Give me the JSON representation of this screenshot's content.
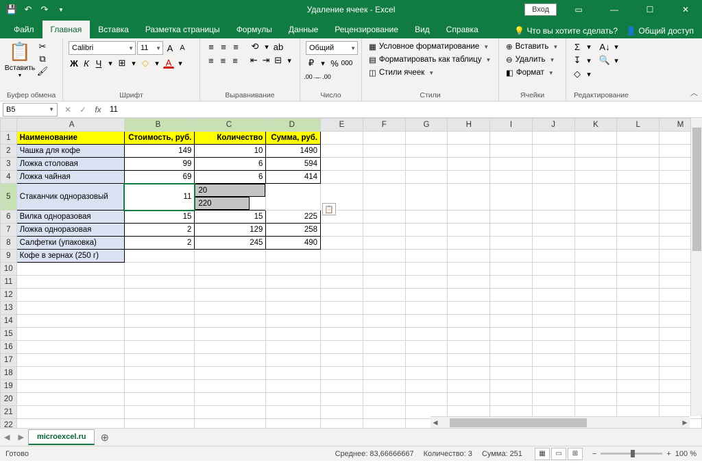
{
  "app": {
    "title": "Удаление ячеек  -  Excel",
    "login": "Вход"
  },
  "tabs": [
    "Файл",
    "Главная",
    "Вставка",
    "Разметка страницы",
    "Формулы",
    "Данные",
    "Рецензирование",
    "Вид",
    "Справка"
  ],
  "tellme": "Что вы хотите сделать?",
  "share": "Общий доступ",
  "ribbon": {
    "clipboard": {
      "label": "Буфер обмена",
      "paste": "Вставить"
    },
    "font": {
      "label": "Шрифт",
      "name": "Calibri",
      "size": "11",
      "bold": "Ж",
      "italic": "К",
      "underline": "Ч"
    },
    "align": {
      "label": "Выравнивание"
    },
    "number": {
      "label": "Число",
      "format": "Общий"
    },
    "styles": {
      "label": "Стили",
      "cond": "Условное форматирование",
      "table": "Форматировать как таблицу",
      "cell": "Стили ячеек"
    },
    "cells": {
      "label": "Ячейки",
      "insert": "Вставить",
      "delete": "Удалить",
      "format": "Формат"
    },
    "edit": {
      "label": "Редактирование"
    }
  },
  "namebox": "B5",
  "formula": "11",
  "cols": [
    "A",
    "B",
    "C",
    "D",
    "E",
    "F",
    "G",
    "H",
    "I",
    "J",
    "K",
    "L",
    "M"
  ],
  "header": [
    "Наименование",
    "Стоимость, руб.",
    "Количество",
    "Сумма, руб."
  ],
  "rows": [
    [
      "Чашка для кофе",
      "149",
      "10",
      "1490"
    ],
    [
      "Ложка столовая",
      "99",
      "6",
      "594"
    ],
    [
      "Ложка чайная",
      "69",
      "6",
      "414"
    ],
    [
      "Стаканчик одноразовый",
      "11",
      "20",
      "220"
    ],
    [
      "Вилка одноразовая",
      "15",
      "15",
      "225"
    ],
    [
      "Ложка одноразовая",
      "2",
      "129",
      "258"
    ],
    [
      "Салфетки (упаковка)",
      "2",
      "245",
      "490"
    ],
    [
      "Кофе в зернах (250 г)",
      "",
      "",
      ""
    ]
  ],
  "sheet": "microexcel.ru",
  "status": {
    "ready": "Готово",
    "avg": "Среднее: 83,66666667",
    "count": "Количество: 3",
    "sum": "Сумма: 251",
    "zoom": "100 %"
  }
}
